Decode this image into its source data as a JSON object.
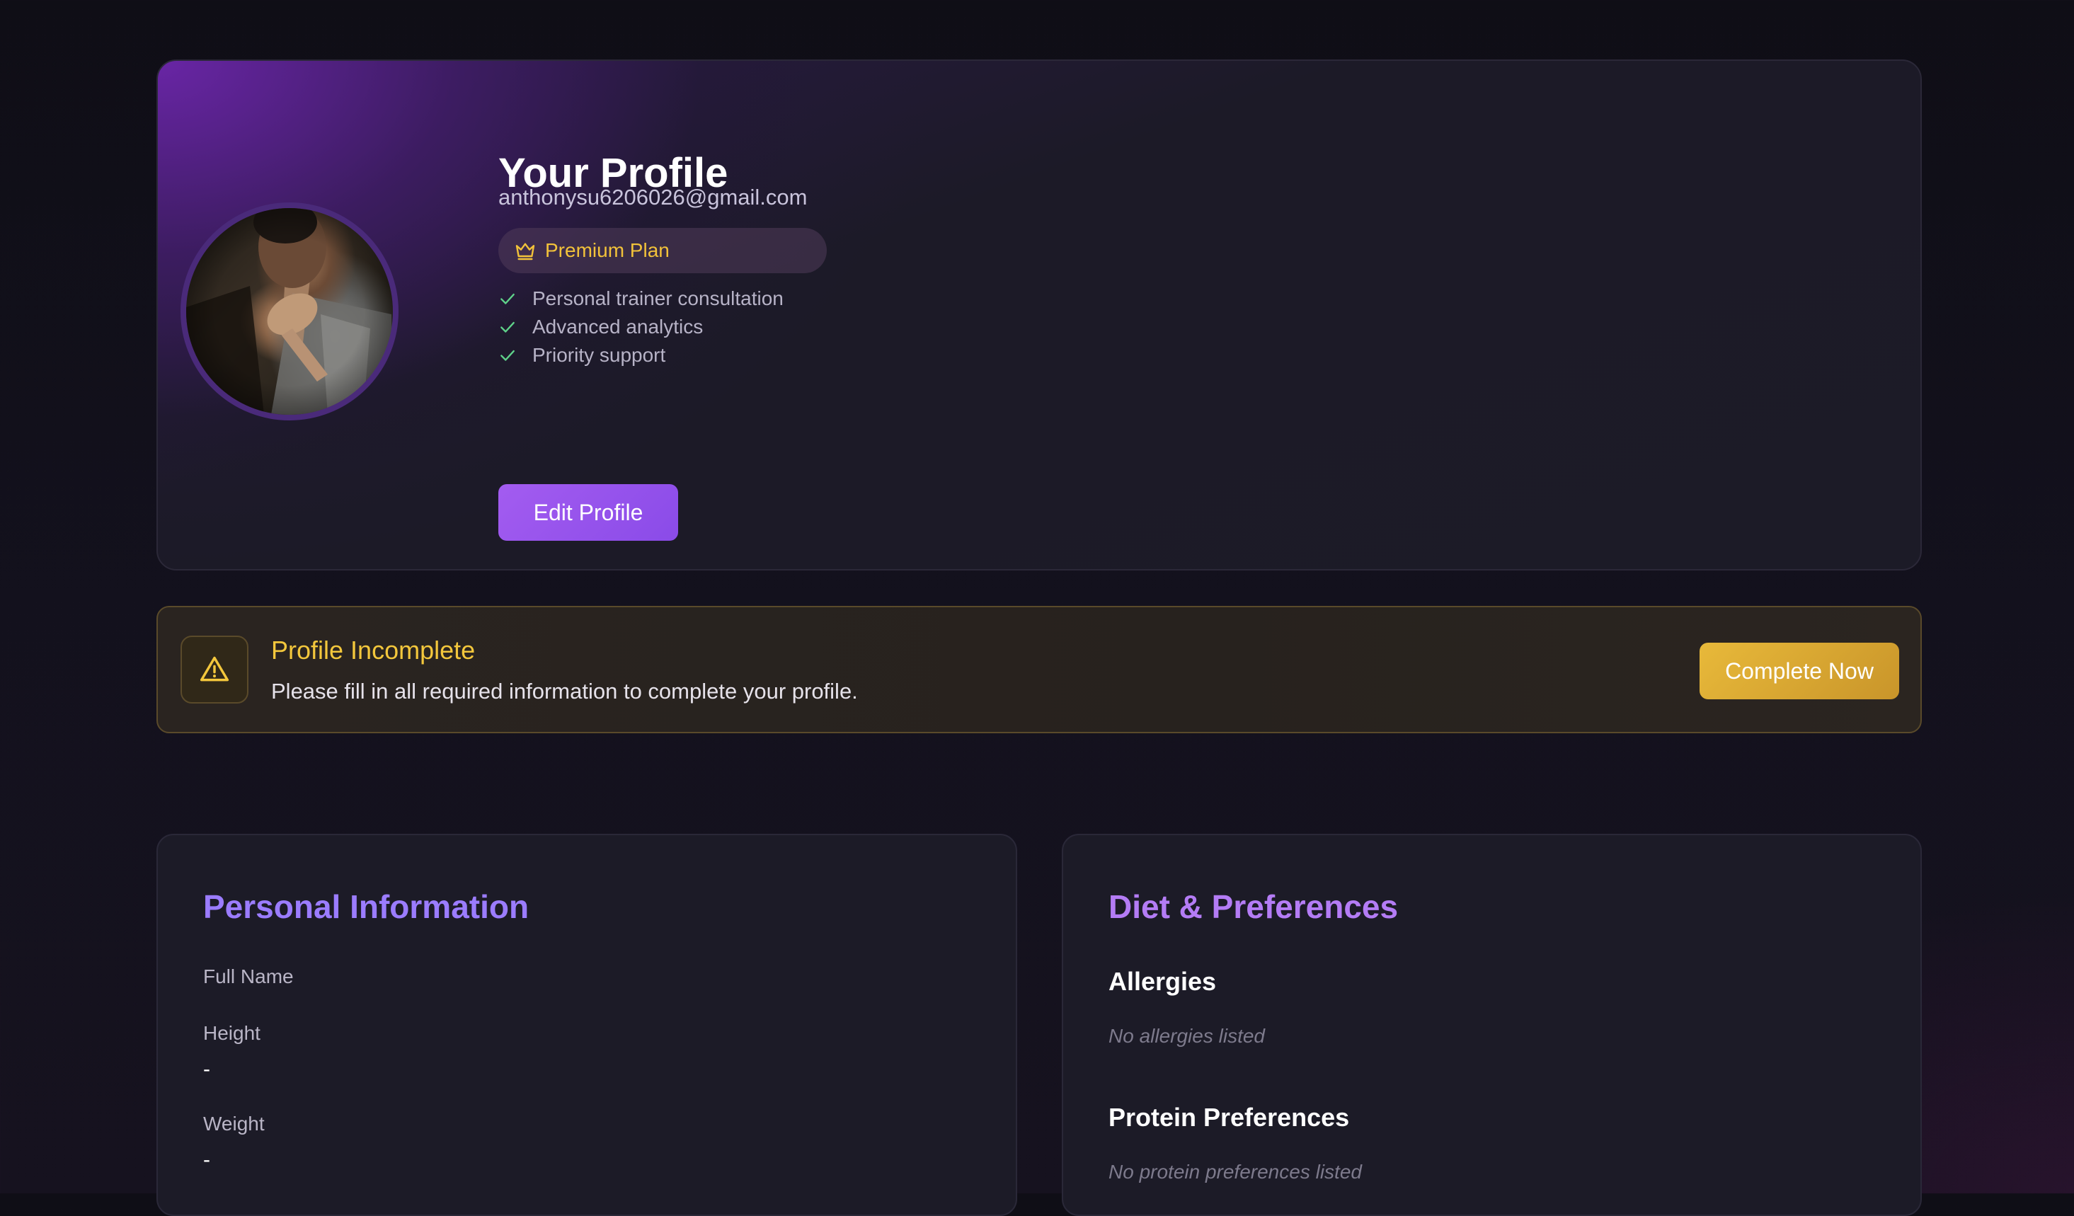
{
  "profile": {
    "title": "Your Profile",
    "email": "anthonysu6206026@gmail.com",
    "plan_label": "Premium Plan",
    "features": [
      "Personal trainer consultation",
      "Advanced analytics",
      "Priority support"
    ],
    "edit_button": "Edit Profile"
  },
  "alert": {
    "title": "Profile Incomplete",
    "message": "Please fill in all required information to complete your profile.",
    "button": "Complete Now"
  },
  "personal_info": {
    "title": "Personal Information",
    "fields": [
      {
        "label": "Full Name",
        "value": ""
      },
      {
        "label": "Height",
        "value": "-"
      },
      {
        "label": "Weight",
        "value": "-"
      }
    ]
  },
  "diet": {
    "title": "Diet & Preferences",
    "sections": [
      {
        "heading": "Allergies",
        "empty_text": "No allergies listed"
      },
      {
        "heading": "Protein Preferences",
        "empty_text": "No protein preferences listed"
      }
    ]
  },
  "icons": {
    "plan": "crown-icon",
    "feature": "check-icon",
    "alert": "warning-triangle-icon"
  },
  "colors": {
    "accent_purple": "#9b5cf0",
    "plan_gold": "#f2c23a",
    "check_green": "#5fd28a",
    "warning_gold": "#f3c73c",
    "section_title_purple": "#9b7cff"
  }
}
